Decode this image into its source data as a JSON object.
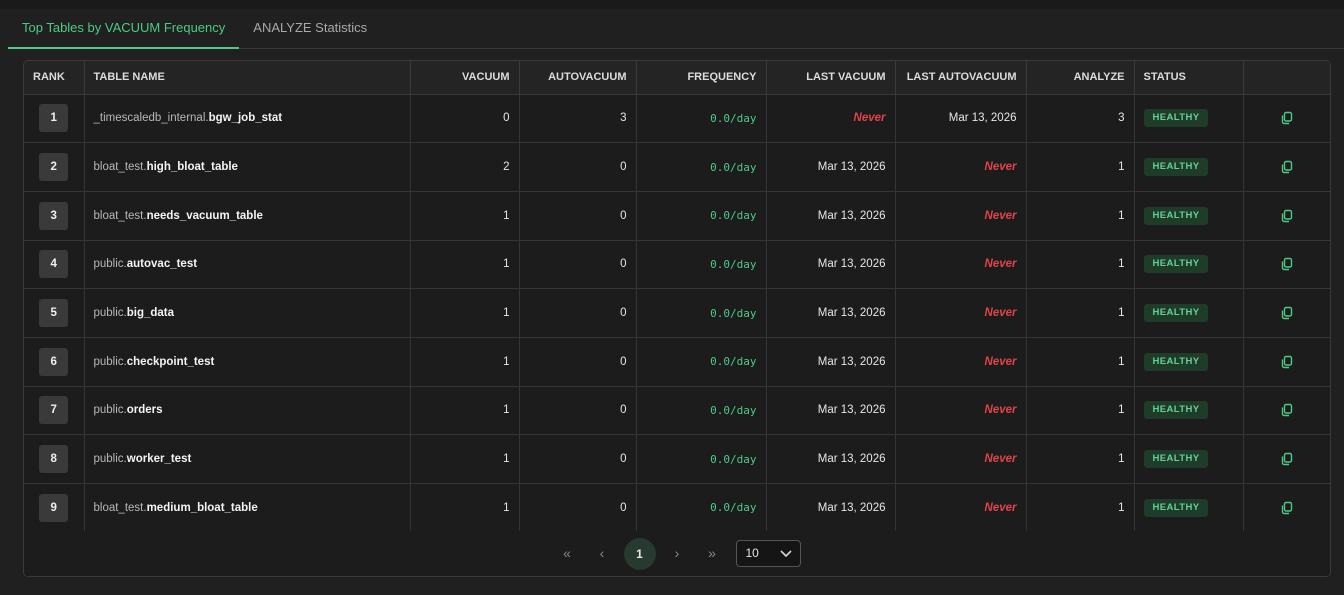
{
  "tabs": [
    {
      "label": "Top Tables by VACUUM Frequency",
      "active": true
    },
    {
      "label": "ANALYZE Statistics",
      "active": false
    }
  ],
  "table": {
    "headers": {
      "rank": "RANK",
      "table_name": "TABLE NAME",
      "vacuum": "VACUUM",
      "autovacuum": "AUTOVACUUM",
      "frequency": "FREQUENCY",
      "last_vacuum": "LAST VACUUM",
      "last_autovacuum": "LAST AUTOVACUUM",
      "analyze": "ANALYZE",
      "status": "STATUS"
    },
    "rows": [
      {
        "rank": "1",
        "schema": "_timescaledb_internal.",
        "name": "bgw_job_stat",
        "vacuum": "0",
        "autovacuum": "3",
        "frequency": "0.0/day",
        "last_vacuum": "Never",
        "last_autovacuum": "Mar 13, 2026",
        "analyze": "3",
        "status": "HEALTHY"
      },
      {
        "rank": "2",
        "schema": "bloat_test.",
        "name": "high_bloat_table",
        "vacuum": "2",
        "autovacuum": "0",
        "frequency": "0.0/day",
        "last_vacuum": "Mar 13, 2026",
        "last_autovacuum": "Never",
        "analyze": "1",
        "status": "HEALTHY"
      },
      {
        "rank": "3",
        "schema": "bloat_test.",
        "name": "needs_vacuum_table",
        "vacuum": "1",
        "autovacuum": "0",
        "frequency": "0.0/day",
        "last_vacuum": "Mar 13, 2026",
        "last_autovacuum": "Never",
        "analyze": "1",
        "status": "HEALTHY"
      },
      {
        "rank": "4",
        "schema": "public.",
        "name": "autovac_test",
        "vacuum": "1",
        "autovacuum": "0",
        "frequency": "0.0/day",
        "last_vacuum": "Mar 13, 2026",
        "last_autovacuum": "Never",
        "analyze": "1",
        "status": "HEALTHY"
      },
      {
        "rank": "5",
        "schema": "public.",
        "name": "big_data",
        "vacuum": "1",
        "autovacuum": "0",
        "frequency": "0.0/day",
        "last_vacuum": "Mar 13, 2026",
        "last_autovacuum": "Never",
        "analyze": "1",
        "status": "HEALTHY"
      },
      {
        "rank": "6",
        "schema": "public.",
        "name": "checkpoint_test",
        "vacuum": "1",
        "autovacuum": "0",
        "frequency": "0.0/day",
        "last_vacuum": "Mar 13, 2026",
        "last_autovacuum": "Never",
        "analyze": "1",
        "status": "HEALTHY"
      },
      {
        "rank": "7",
        "schema": "public.",
        "name": "orders",
        "vacuum": "1",
        "autovacuum": "0",
        "frequency": "0.0/day",
        "last_vacuum": "Mar 13, 2026",
        "last_autovacuum": "Never",
        "analyze": "1",
        "status": "HEALTHY"
      },
      {
        "rank": "8",
        "schema": "public.",
        "name": "worker_test",
        "vacuum": "1",
        "autovacuum": "0",
        "frequency": "0.0/day",
        "last_vacuum": "Mar 13, 2026",
        "last_autovacuum": "Never",
        "analyze": "1",
        "status": "HEALTHY"
      },
      {
        "rank": "9",
        "schema": "bloat_test.",
        "name": "medium_bloat_table",
        "vacuum": "1",
        "autovacuum": "0",
        "frequency": "0.0/day",
        "last_vacuum": "Mar 13, 2026",
        "last_autovacuum": "Never",
        "analyze": "1",
        "status": "HEALTHY"
      }
    ]
  },
  "pagination": {
    "first": "«",
    "prev": "‹",
    "current_page": "1",
    "next": "›",
    "last": "»",
    "page_size": "10"
  },
  "colors": {
    "accent": "#4ec986",
    "never": "#e0434b",
    "badge_bg": "#1f3b2a"
  },
  "icons": {
    "row_action": "copy-icon",
    "page_size_dropdown": "chevron-down-icon"
  }
}
